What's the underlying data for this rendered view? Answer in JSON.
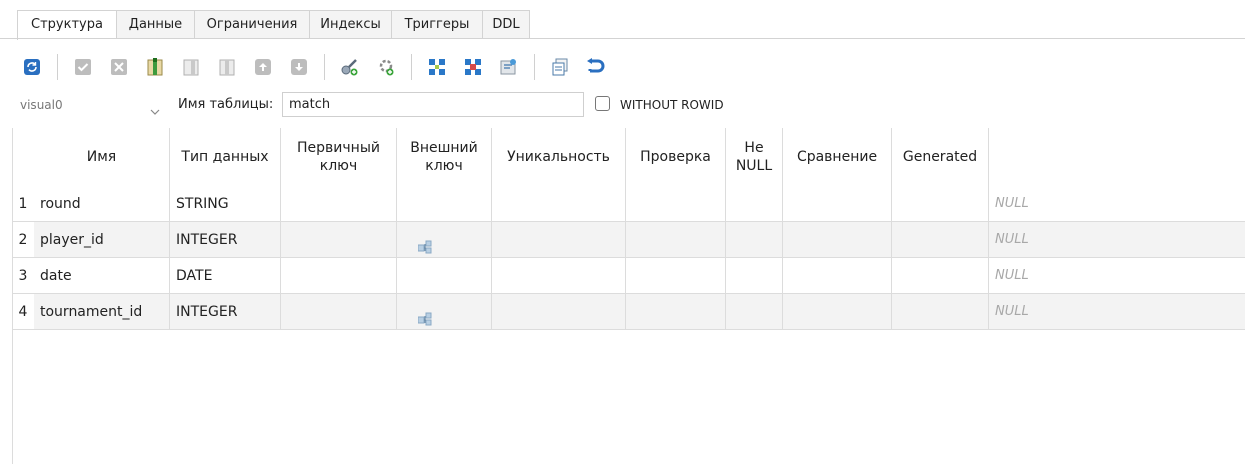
{
  "tabs": [
    {
      "label": "Структура",
      "active": true
    },
    {
      "label": "Данные"
    },
    {
      "label": "Ограничения"
    },
    {
      "label": "Индексы"
    },
    {
      "label": "Триггеры"
    },
    {
      "label": "DDL"
    }
  ],
  "toolbar": {
    "icons": [
      "refresh-icon",
      "commit-icon",
      "rollback-icon",
      "add-column-icon",
      "insert-column-icon",
      "delete-column-icon",
      "move-up-icon",
      "move-down-icon",
      "add-primary-key-icon",
      "add-foreign-key-icon",
      "add-unique-icon",
      "add-check-icon",
      "add-collation-icon",
      "copy-icon",
      "undo-icon"
    ]
  },
  "table_form": {
    "database_value": "visual0",
    "table_name_label": "Имя таблицы:",
    "table_name_value": "match",
    "without_rowid_label": "WITHOUT ROWID",
    "without_rowid_checked": false
  },
  "columns_grid": {
    "headers": [
      "Имя",
      "Тип данных",
      "Первичный\nключ",
      "Внешний\nключ",
      "Уникальность",
      "Проверка",
      "Не\nNULL",
      "Сравнение",
      "Generated"
    ],
    "rows": [
      {
        "num": "1",
        "name": "round",
        "type": "STRING",
        "foreign_key": false,
        "default": "NULL"
      },
      {
        "num": "2",
        "name": "player_id",
        "type": "INTEGER",
        "foreign_key": true,
        "default": "NULL"
      },
      {
        "num": "3",
        "name": "date",
        "type": "DATE",
        "foreign_key": false,
        "default": "NULL"
      },
      {
        "num": "4",
        "name": "tournament_id",
        "type": "INTEGER",
        "foreign_key": true,
        "default": "NULL"
      }
    ]
  },
  "colors": {
    "accent": "#2a78c8",
    "grid_line": "#dcdcdc",
    "alt_row": "#f3f3f3",
    "null_text": "#a8a8a8"
  }
}
